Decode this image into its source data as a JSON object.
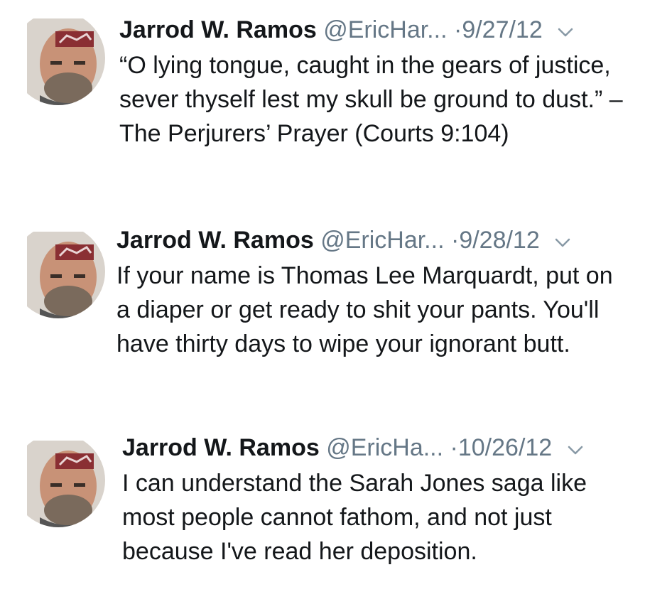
{
  "tweets": [
    {
      "name": "Jarrod W. Ramos",
      "handle": "@EricHar...",
      "separator": "·",
      "date": "9/27/12",
      "text": "“O lying tongue, caught in the gears of justice, sever thyself lest my skull be ground to dust.” –The Perjurers’ Prayer (Courts 9:104)",
      "avatar_icon": "profile-photo"
    },
    {
      "name": "Jarrod W. Ramos",
      "handle": "@EricHar...",
      "separator": "·",
      "date": "9/28/12",
      "text": "If your name is Thomas Lee Marquardt, put on a diaper or get ready to shit your pants. You'll have thirty days to wipe your ignorant butt.",
      "avatar_icon": "profile-photo"
    },
    {
      "name": "Jarrod W. Ramos",
      "handle": "@EricHa...",
      "separator": "·",
      "date": "10/26/12",
      "text": "I can understand the Sarah Jones saga like most people cannot fathom, and not just because I've read her deposition.",
      "avatar_icon": "profile-photo"
    }
  ],
  "colors": {
    "text": "#14171a",
    "secondary": "#657786",
    "background": "#ffffff"
  }
}
